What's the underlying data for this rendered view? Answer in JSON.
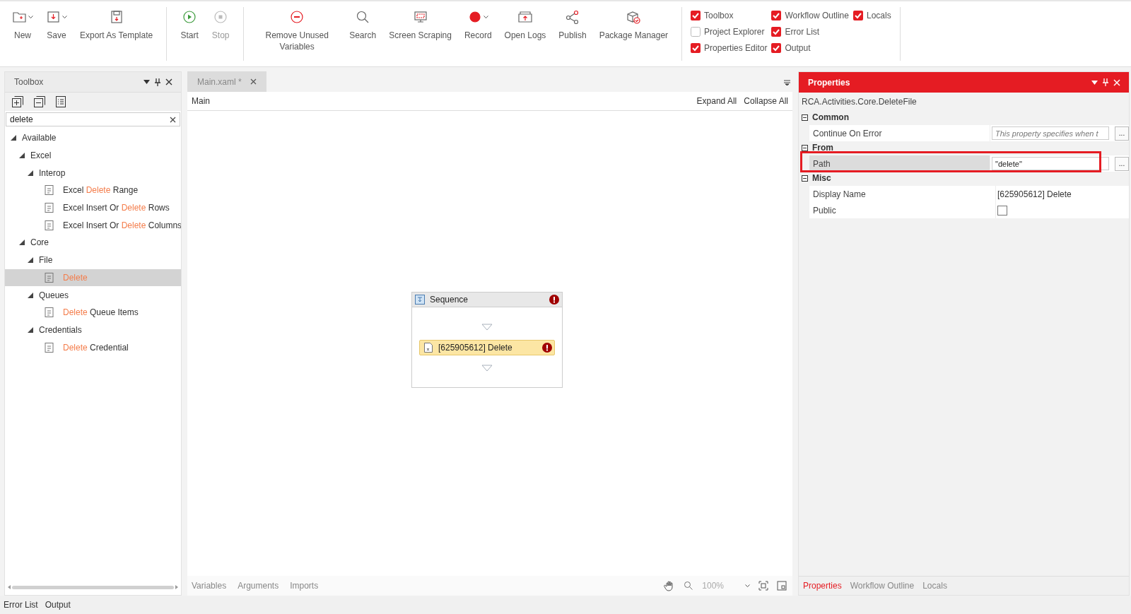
{
  "toolbar": {
    "buttons": [
      {
        "label": "New",
        "dropdown": true
      },
      {
        "label": "Save",
        "dropdown": true
      },
      {
        "label": "Export As Template",
        "dropdown": false
      },
      {
        "label": "Start",
        "dropdown": false,
        "disabled": false
      },
      {
        "label": "Stop",
        "dropdown": false,
        "disabled": true
      },
      {
        "label": "Remove Unused Variables",
        "dropdown": false
      },
      {
        "label": "Search",
        "dropdown": false
      },
      {
        "label": "Screen Scraping",
        "dropdown": false
      },
      {
        "label": "Record",
        "dropdown": true
      },
      {
        "label": "Open Logs",
        "dropdown": false
      },
      {
        "label": "Publish",
        "dropdown": false
      },
      {
        "label": "Package Manager",
        "dropdown": false
      }
    ],
    "panel_toggles": [
      {
        "label": "Toolbox",
        "checked": true
      },
      {
        "label": "Project Explorer",
        "checked": false
      },
      {
        "label": "Properties Editor",
        "checked": true
      },
      {
        "label": "Workflow Outline",
        "checked": true
      },
      {
        "label": "Error List",
        "checked": true
      },
      {
        "label": "Output",
        "checked": true
      },
      {
        "label": "Locals",
        "checked": true
      }
    ]
  },
  "toolbox": {
    "title": "Toolbox",
    "search": {
      "value": "delete"
    },
    "tree": [
      {
        "parts": [
          {
            "text": "Available",
            "match": false
          }
        ],
        "expanded": true,
        "selected": false,
        "children": [
          {
            "parts": [
              {
                "text": "Excel",
                "match": false
              }
            ],
            "expanded": true,
            "selected": false,
            "children": [
              {
                "parts": [
                  {
                    "text": "Interop",
                    "match": false
                  }
                ],
                "expanded": true,
                "selected": false,
                "children": [
                  {
                    "kind": "activity",
                    "parts": [
                      {
                        "text": "Excel ",
                        "match": false
                      },
                      {
                        "text": "Delete",
                        "match": true
                      },
                      {
                        "text": " Range",
                        "match": false
                      }
                    ],
                    "selected": false
                  },
                  {
                    "kind": "activity",
                    "parts": [
                      {
                        "text": "Excel Insert Or ",
                        "match": false
                      },
                      {
                        "text": "Delete",
                        "match": true
                      },
                      {
                        "text": " Rows",
                        "match": false
                      }
                    ],
                    "selected": false
                  },
                  {
                    "kind": "activity",
                    "parts": [
                      {
                        "text": "Excel Insert Or ",
                        "match": false
                      },
                      {
                        "text": "Delete",
                        "match": true
                      },
                      {
                        "text": " Columns",
                        "match": false
                      }
                    ],
                    "selected": false
                  }
                ]
              }
            ]
          },
          {
            "parts": [
              {
                "text": "Core",
                "match": false
              }
            ],
            "expanded": true,
            "selected": false,
            "children": [
              {
                "parts": [
                  {
                    "text": "File",
                    "match": false
                  }
                ],
                "expanded": true,
                "selected": false,
                "children": [
                  {
                    "kind": "activity",
                    "parts": [
                      {
                        "text": "Delete",
                        "match": true
                      }
                    ],
                    "selected": true
                  }
                ]
              },
              {
                "parts": [
                  {
                    "text": "Queues",
                    "match": false
                  }
                ],
                "expanded": true,
                "selected": false,
                "children": [
                  {
                    "kind": "activity",
                    "parts": [
                      {
                        "text": "Delete",
                        "match": true
                      },
                      {
                        "text": " Queue Items",
                        "match": false
                      }
                    ],
                    "selected": false
                  }
                ]
              },
              {
                "parts": [
                  {
                    "text": "Credentials",
                    "match": false
                  }
                ],
                "expanded": true,
                "selected": false,
                "children": [
                  {
                    "kind": "activity",
                    "parts": [
                      {
                        "text": "Delete",
                        "match": true
                      },
                      {
                        "text": " Credential",
                        "match": false
                      }
                    ],
                    "selected": false
                  }
                ]
              }
            ]
          }
        ]
      }
    ]
  },
  "designer": {
    "tabs": [
      {
        "label": "Main.xaml *",
        "selected": true
      }
    ],
    "breadcrumb": "Main",
    "expand_all": "Expand All",
    "collapse_all": "Collapse All",
    "sequence": {
      "title": "Sequence",
      "error": true,
      "activities": [
        {
          "label": "[625905612] Delete",
          "error": true
        }
      ]
    },
    "bottom_tabs": [
      "Variables",
      "Arguments",
      "Imports"
    ],
    "zoom": "100%"
  },
  "properties": {
    "title": "Properties",
    "type_name": "RCA.Activities.Core.DeleteFile",
    "browse_label": "...",
    "categories": [
      {
        "name": "Common",
        "expanded": true,
        "rows": [
          {
            "kind": "text",
            "label": "Continue On Error",
            "placeholder": "This property specifies when t",
            "has_button": true,
            "selected": false,
            "highlighted": false
          }
        ]
      },
      {
        "name": "From",
        "expanded": true,
        "rows": [
          {
            "kind": "text",
            "label": "Path",
            "value": "\"delete\"",
            "has_button": true,
            "selected": true,
            "highlighted": true
          }
        ]
      },
      {
        "name": "Misc",
        "expanded": true,
        "rows": [
          {
            "kind": "plain",
            "label": "Display Name",
            "value": "[625905612] Delete",
            "selected": false,
            "highlighted": false
          },
          {
            "kind": "checkbox",
            "label": "Public",
            "checked": false,
            "selected": false,
            "highlighted": false
          }
        ]
      }
    ],
    "tabs": [
      {
        "label": "Properties",
        "selected": true
      },
      {
        "label": "Workflow Outline",
        "selected": false
      },
      {
        "label": "Locals",
        "selected": false
      }
    ]
  },
  "bottom_panel_tabs": [
    "Error List",
    "Output"
  ]
}
